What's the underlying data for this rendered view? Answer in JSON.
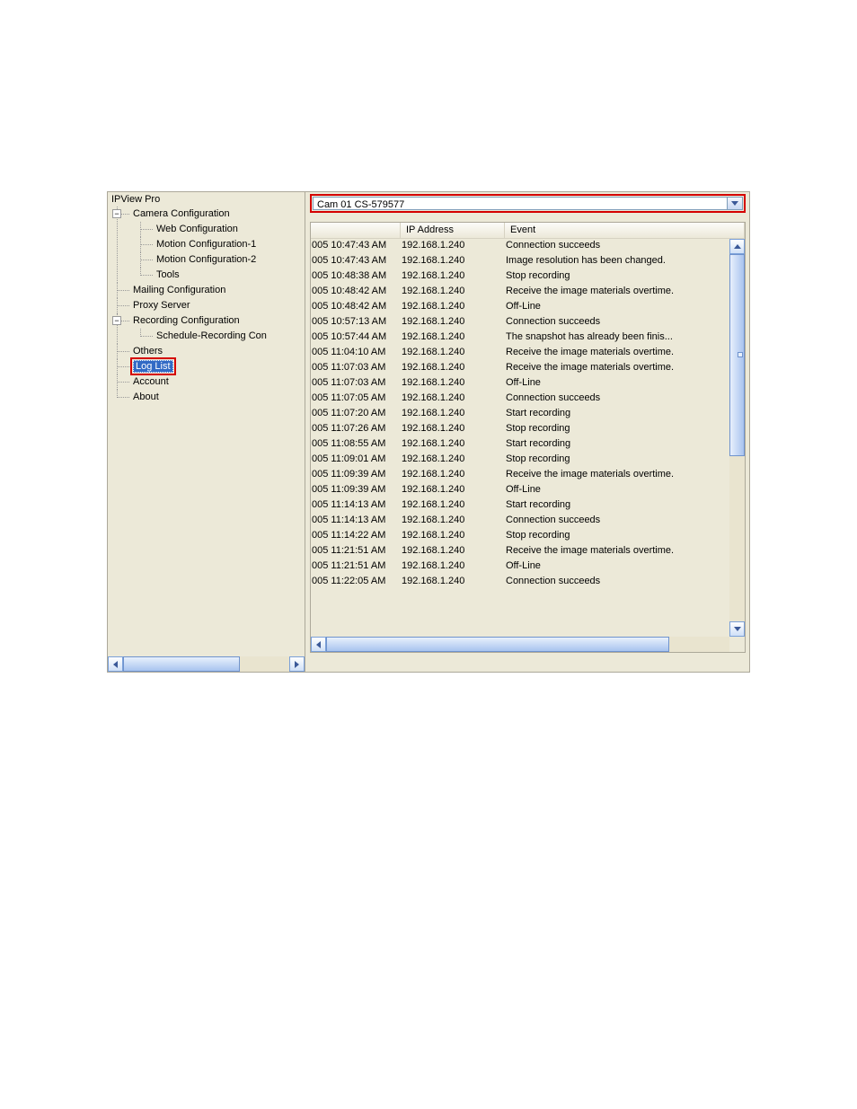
{
  "app": {
    "title": "IPView Pro"
  },
  "tree": {
    "root": {
      "label": "Camera Configuration",
      "children": [
        {
          "label": "Web Configuration"
        },
        {
          "label": "Motion Configuration-1"
        },
        {
          "label": "Motion Configuration-2"
        },
        {
          "label": "Tools"
        }
      ]
    },
    "mailing": {
      "label": "Mailing Configuration"
    },
    "proxy": {
      "label": "Proxy Server"
    },
    "recording": {
      "label": "Recording Configuration",
      "children": [
        {
          "label": "Schedule-Recording Con"
        }
      ]
    },
    "others": {
      "label": "Others"
    },
    "loglist": {
      "label": "Log List"
    },
    "account": {
      "label": "Account"
    },
    "about": {
      "label": "About"
    }
  },
  "combo": {
    "text": "Cam 01     CS-579577"
  },
  "table": {
    "headers": {
      "time": "",
      "ip": "IP Address",
      "event": "Event"
    },
    "rows": [
      {
        "time": "005 10:47:43 AM",
        "ip": "192.168.1.240",
        "event": "Connection succeeds"
      },
      {
        "time": "005 10:47:43 AM",
        "ip": "192.168.1.240",
        "event": "Image resolution has been changed."
      },
      {
        "time": "005 10:48:38 AM",
        "ip": "192.168.1.240",
        "event": "Stop recording"
      },
      {
        "time": "005 10:48:42 AM",
        "ip": "192.168.1.240",
        "event": "Receive the image materials overtime."
      },
      {
        "time": "005 10:48:42 AM",
        "ip": "192.168.1.240",
        "event": "Off-Line"
      },
      {
        "time": "005 10:57:13 AM",
        "ip": "192.168.1.240",
        "event": "Connection succeeds"
      },
      {
        "time": "005 10:57:44 AM",
        "ip": "192.168.1.240",
        "event": "The snapshot has already been finis..."
      },
      {
        "time": "005 11:04:10 AM",
        "ip": "192.168.1.240",
        "event": "Receive the image materials overtime."
      },
      {
        "time": "005 11:07:03 AM",
        "ip": "192.168.1.240",
        "event": "Receive the image materials overtime."
      },
      {
        "time": "005 11:07:03 AM",
        "ip": "192.168.1.240",
        "event": "Off-Line"
      },
      {
        "time": "005 11:07:05 AM",
        "ip": "192.168.1.240",
        "event": "Connection succeeds"
      },
      {
        "time": "005 11:07:20 AM",
        "ip": "192.168.1.240",
        "event": "Start recording"
      },
      {
        "time": "005 11:07:26 AM",
        "ip": "192.168.1.240",
        "event": "Stop recording"
      },
      {
        "time": "005 11:08:55 AM",
        "ip": "192.168.1.240",
        "event": "Start recording"
      },
      {
        "time": "005 11:09:01 AM",
        "ip": "192.168.1.240",
        "event": "Stop recording"
      },
      {
        "time": "005 11:09:39 AM",
        "ip": "192.168.1.240",
        "event": "Receive the image materials overtime."
      },
      {
        "time": "005 11:09:39 AM",
        "ip": "192.168.1.240",
        "event": "Off-Line"
      },
      {
        "time": "005 11:14:13 AM",
        "ip": "192.168.1.240",
        "event": "Start recording"
      },
      {
        "time": "005 11:14:13 AM",
        "ip": "192.168.1.240",
        "event": "Connection succeeds"
      },
      {
        "time": "005 11:14:22 AM",
        "ip": "192.168.1.240",
        "event": "Stop recording"
      },
      {
        "time": "005 11:21:51 AM",
        "ip": "192.168.1.240",
        "event": "Receive the image materials overtime."
      },
      {
        "time": "005 11:21:51 AM",
        "ip": "192.168.1.240",
        "event": "Off-Line"
      },
      {
        "time": "005 11:22:05 AM",
        "ip": "192.168.1.240",
        "event": "Connection succeeds"
      }
    ]
  },
  "expander_minus": "−"
}
